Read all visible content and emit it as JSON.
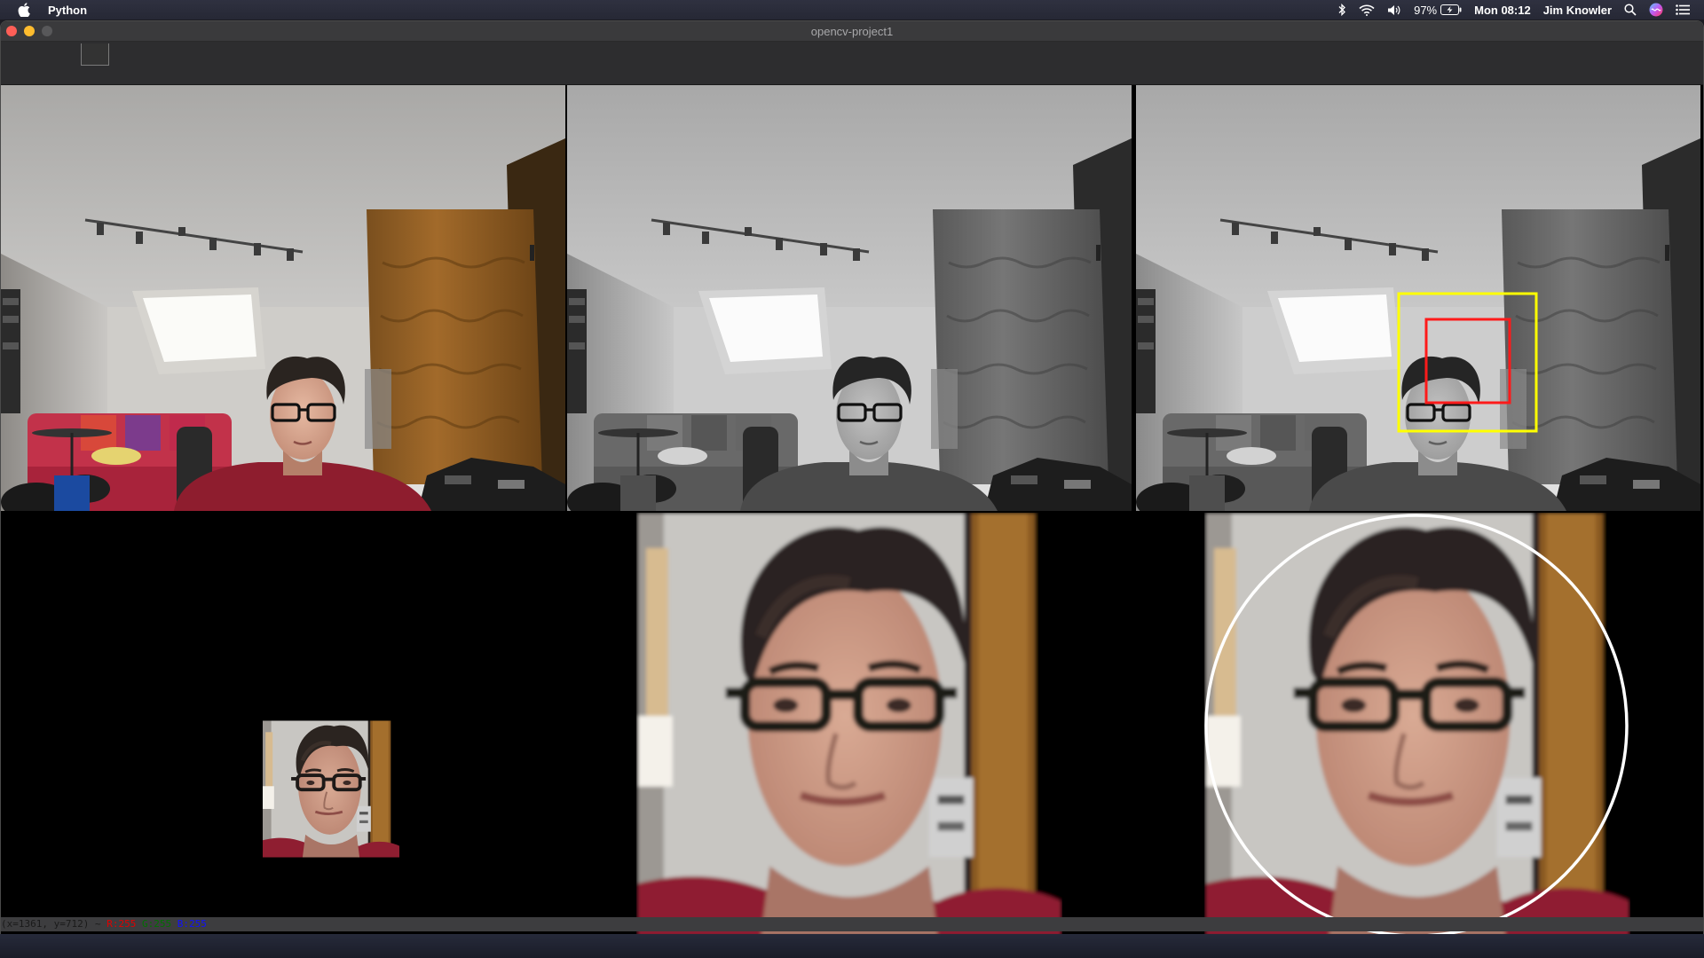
{
  "menubar": {
    "app_name": "Python",
    "battery": "97%",
    "clock": "Mon 08:12",
    "user": "Jim Knowler",
    "icons": [
      "apple-icon",
      "bluetooth-icon",
      "wifi-icon",
      "volume-icon",
      "battery-icon",
      "spotlight-icon",
      "siri-icon",
      "notification-center-icon"
    ]
  },
  "window": {
    "title": "opencv-project1"
  },
  "status": {
    "coords": "(x=1361, y=712) ~ ",
    "r": "R:255",
    "g": "G:255",
    "b": "B:255"
  },
  "panels": [
    {
      "name": "original-color-frame",
      "style": "color"
    },
    {
      "name": "grayscale-frame",
      "style": "grayscale"
    },
    {
      "name": "detection-frame",
      "style": "grayscale",
      "overlays": [
        {
          "shape": "rectangle",
          "color": "#ffff00"
        },
        {
          "shape": "rectangle",
          "color": "#ff0000"
        }
      ]
    },
    {
      "name": "face-thumbnail",
      "style": "color"
    },
    {
      "name": "face-zoom",
      "style": "color"
    },
    {
      "name": "face-zoom-circled",
      "style": "color",
      "overlays": [
        {
          "shape": "circle",
          "color": "#ffffff"
        }
      ]
    }
  ]
}
